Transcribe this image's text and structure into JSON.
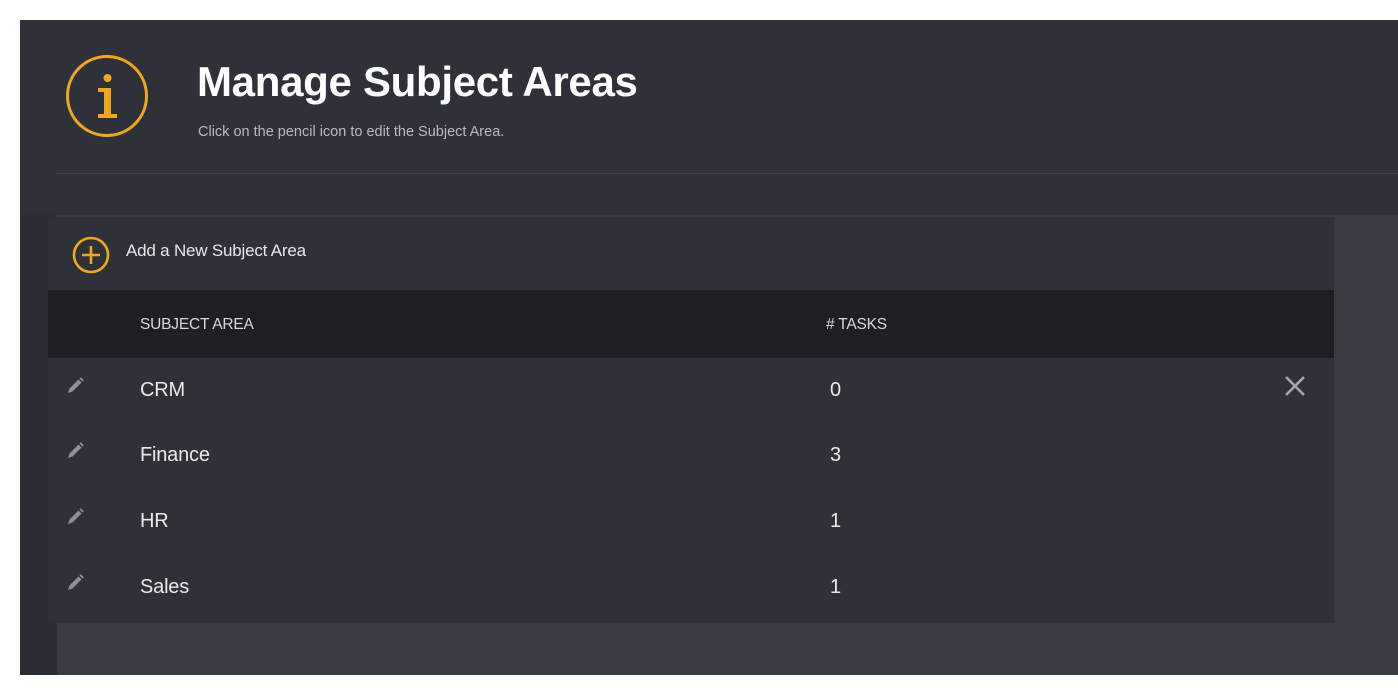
{
  "header": {
    "title": "Manage Subject Areas",
    "subtitle": "Click on the pencil icon to edit the Subject Area."
  },
  "add": {
    "label": "Add a New Subject Area"
  },
  "table": {
    "columns": [
      "SUBJECT AREA",
      "# TASKS"
    ],
    "rows": [
      {
        "subject": "CRM",
        "tasks": "0"
      },
      {
        "subject": "Finance",
        "tasks": "3"
      },
      {
        "subject": "HR",
        "tasks": "1"
      },
      {
        "subject": "Sales",
        "tasks": "1"
      }
    ]
  },
  "colors": {
    "accent": "#f0a71e",
    "background": "#2c2e35",
    "header_row": "#1d1f24"
  },
  "icons": {
    "header": "info-icon",
    "add": "plus-circle-icon",
    "edit": "pencil-icon",
    "delete": "close-icon"
  }
}
